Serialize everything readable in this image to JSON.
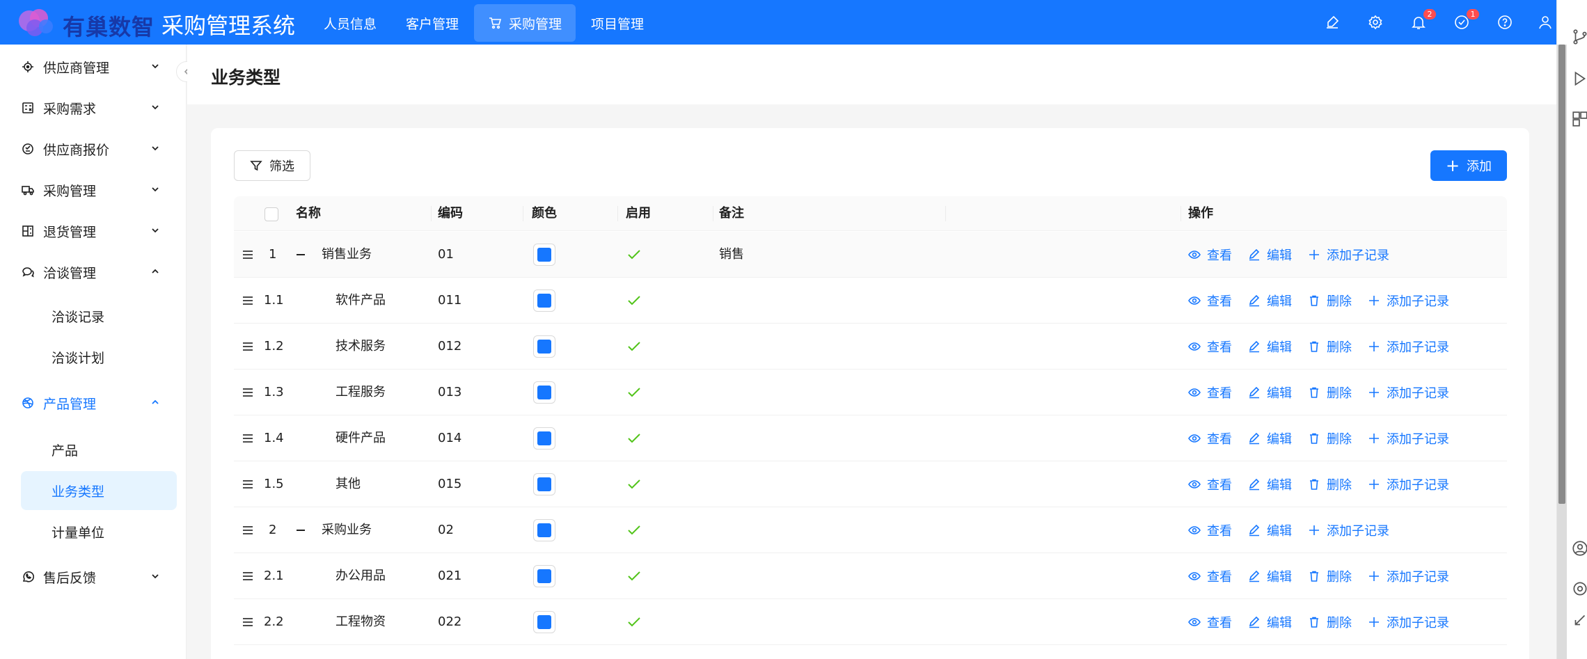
{
  "header": {
    "logo_text": "有巢数智",
    "app_title": "采购管理系统",
    "nav": [
      "人员信息",
      "客户管理",
      "采购管理",
      "项目管理"
    ],
    "active_nav": "采购管理",
    "badges": {
      "notifications": "2",
      "tasks": "1"
    },
    "icons": [
      "brush-icon",
      "settings-icon",
      "bell-icon",
      "check-circle-icon",
      "help-icon",
      "user-icon"
    ]
  },
  "sidebar": {
    "items": [
      {
        "label": "供应商管理",
        "icon": "target-icon",
        "expanded": false
      },
      {
        "label": "采购需求",
        "icon": "calculator-icon",
        "expanded": false
      },
      {
        "label": "供应商报价",
        "icon": "quote-icon",
        "expanded": false
      },
      {
        "label": "采购管理",
        "icon": "truck-icon",
        "expanded": false
      },
      {
        "label": "退货管理",
        "icon": "return-icon",
        "expanded": false
      },
      {
        "label": "洽谈管理",
        "icon": "chat-icon",
        "expanded": true,
        "children": [
          "洽谈记录",
          "洽谈计划"
        ]
      },
      {
        "label": "产品管理",
        "icon": "dribbble-icon",
        "expanded": true,
        "children": [
          "产品",
          "业务类型",
          "计量单位"
        ]
      },
      {
        "label": "售后反馈",
        "icon": "whatsapp-icon",
        "expanded": false
      }
    ],
    "selected": "业务类型"
  },
  "page": {
    "title": "业务类型",
    "filter_label": "筛选",
    "add_label": "添加"
  },
  "table": {
    "columns": [
      "名称",
      "编码",
      "颜色",
      "启用",
      "备注",
      "操作"
    ],
    "actions": {
      "view": "查看",
      "edit": "编辑",
      "delete": "删除",
      "add_child": "添加子记录"
    },
    "rows": [
      {
        "index": "1",
        "name": "销售业务",
        "code": "01",
        "color": "#1677ff",
        "enabled": true,
        "remark": "销售",
        "level": 0,
        "deletable": false
      },
      {
        "index": "1.1",
        "name": "软件产品",
        "code": "011",
        "color": "#1677ff",
        "enabled": true,
        "remark": "",
        "level": 1,
        "deletable": true
      },
      {
        "index": "1.2",
        "name": "技术服务",
        "code": "012",
        "color": "#1677ff",
        "enabled": true,
        "remark": "",
        "level": 1,
        "deletable": true
      },
      {
        "index": "1.3",
        "name": "工程服务",
        "code": "013",
        "color": "#1677ff",
        "enabled": true,
        "remark": "",
        "level": 1,
        "deletable": true
      },
      {
        "index": "1.4",
        "name": "硬件产品",
        "code": "014",
        "color": "#1677ff",
        "enabled": true,
        "remark": "",
        "level": 1,
        "deletable": true
      },
      {
        "index": "1.5",
        "name": "其他",
        "code": "015",
        "color": "#1677ff",
        "enabled": true,
        "remark": "",
        "level": 1,
        "deletable": true
      },
      {
        "index": "2",
        "name": "采购业务",
        "code": "02",
        "color": "#1677ff",
        "enabled": true,
        "remark": "",
        "level": 0,
        "deletable": false
      },
      {
        "index": "2.1",
        "name": "办公用品",
        "code": "021",
        "color": "#1677ff",
        "enabled": true,
        "remark": "",
        "level": 1,
        "deletable": true
      },
      {
        "index": "2.2",
        "name": "工程物资",
        "code": "022",
        "color": "#1677ff",
        "enabled": true,
        "remark": "",
        "level": 1,
        "deletable": true
      }
    ]
  }
}
